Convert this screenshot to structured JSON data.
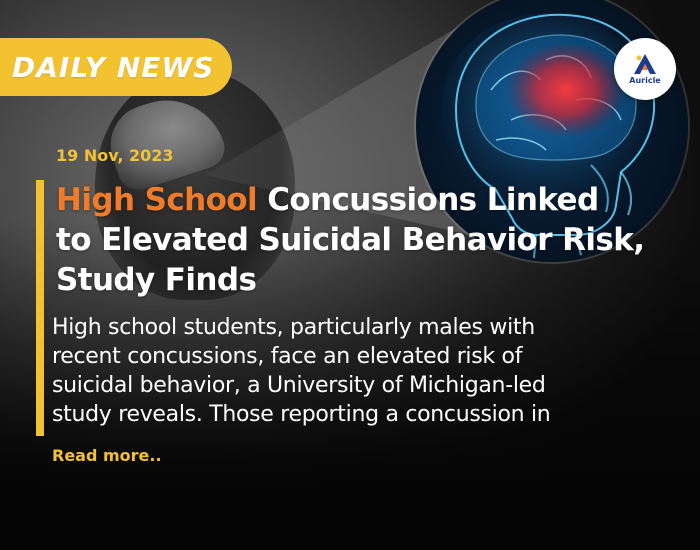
{
  "badge": {
    "label": "DAILY NEWS"
  },
  "logo": {
    "text": "Auricle"
  },
  "article": {
    "date": "19 Nov, 2023",
    "headline_highlight": "High School",
    "headline_rest_1": " Concussions Linked",
    "headline_line_2": "to Elevated Suicidal Behavior Risk,",
    "headline_line_3": "Study Finds",
    "summary_lines": [
      "High school students, particularly males with",
      "recent concussions, face an elevated risk of",
      "suicidal behavior, a University of Michigan-led",
      "study reveals. Those reporting a concussion in"
    ],
    "read_more": "Read more.."
  },
  "colors": {
    "accent_yellow": "#f2c230",
    "headline_orange": "#f07c2a",
    "logo_blue": "#1d3c8f"
  }
}
